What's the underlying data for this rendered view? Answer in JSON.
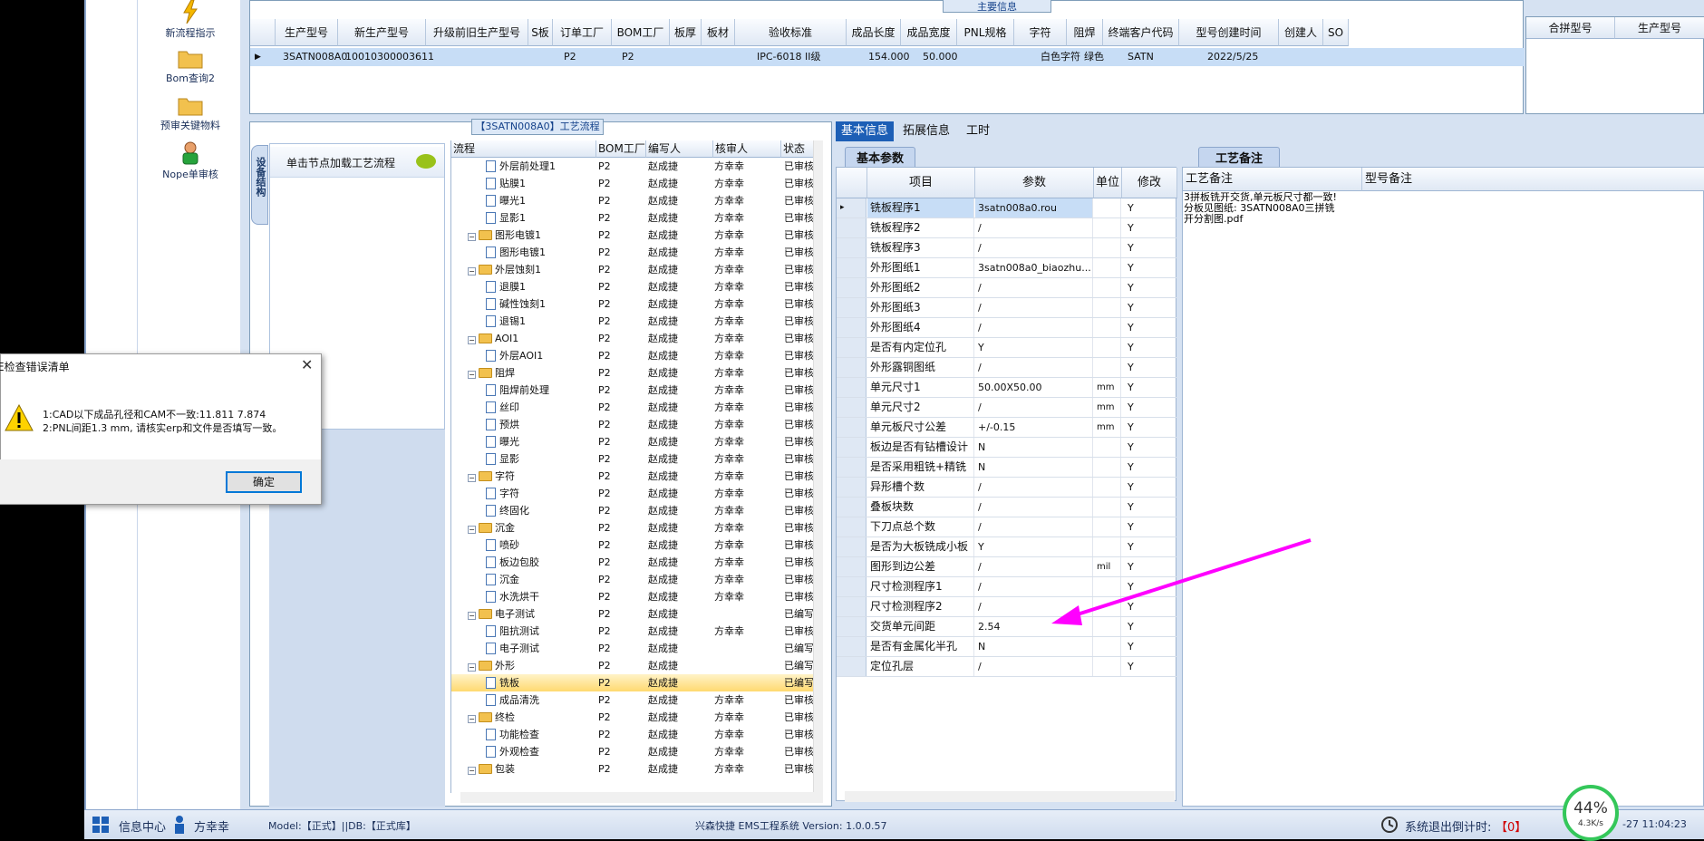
{
  "nav": {
    "items": [
      {
        "label": "新流程指示",
        "icon": "lightning-icon"
      },
      {
        "label": "Bom查询2",
        "icon": "folder-icon"
      },
      {
        "label": "预审关键物料",
        "icon": "folder-icon"
      },
      {
        "label": "Nope单审核",
        "icon": "user-icon"
      }
    ]
  },
  "main_info": {
    "caption": "主要信息",
    "headers": [
      "生产型号",
      "新生产型号",
      "升级前旧生产型号",
      "S板",
      "订单工厂",
      "BOM工厂",
      "板厚",
      "板材",
      "验收标准",
      "成品长度",
      "成品宽度",
      "PNL规格",
      "字符",
      "阻焊",
      "终端客户代码",
      "型号创建时间",
      "创建人",
      "SO"
    ],
    "row": [
      "3SATN008A0",
      "10010300003611",
      "",
      "",
      "P2",
      "P2",
      "",
      "",
      "IPC-6018 II级",
      "154.000",
      "50.000",
      "",
      "白色字符",
      "绿色",
      "SATN",
      "2022/5/25",
      "",
      ""
    ]
  },
  "right_grid": {
    "headers": [
      "合拼型号",
      "生产型号"
    ]
  },
  "flow": {
    "title": "【3SATN008A0】工艺流程",
    "side_tab": "设备结构",
    "load_hint": "单击节点加载工艺流程",
    "headers": [
      "流程",
      "BOM工厂",
      "编写人",
      "核审人",
      "状态"
    ],
    "rows": [
      {
        "n": "外层前处理1",
        "lvl": 2,
        "bom": "P2",
        "w": "赵成捷",
        "r": "方幸幸",
        "s": "已审核"
      },
      {
        "n": "贴膜1",
        "lvl": 2,
        "bom": "P2",
        "w": "赵成捷",
        "r": "方幸幸",
        "s": "已审核"
      },
      {
        "n": "曝光1",
        "lvl": 2,
        "bom": "P2",
        "w": "赵成捷",
        "r": "方幸幸",
        "s": "已审核"
      },
      {
        "n": "显影1",
        "lvl": 2,
        "bom": "P2",
        "w": "赵成捷",
        "r": "方幸幸",
        "s": "已审核"
      },
      {
        "n": "图形电镀1",
        "lvl": 1,
        "bom": "P2",
        "w": "赵成捷",
        "r": "方幸幸",
        "s": "已审核"
      },
      {
        "n": "图形电镀1",
        "lvl": 2,
        "bom": "P2",
        "w": "赵成捷",
        "r": "方幸幸",
        "s": "已审核"
      },
      {
        "n": "外层蚀刻1",
        "lvl": 1,
        "bom": "P2",
        "w": "赵成捷",
        "r": "方幸幸",
        "s": "已审核"
      },
      {
        "n": "退膜1",
        "lvl": 2,
        "bom": "P2",
        "w": "赵成捷",
        "r": "方幸幸",
        "s": "已审核"
      },
      {
        "n": "碱性蚀刻1",
        "lvl": 2,
        "bom": "P2",
        "w": "赵成捷",
        "r": "方幸幸",
        "s": "已审核"
      },
      {
        "n": "退锡1",
        "lvl": 2,
        "bom": "P2",
        "w": "赵成捷",
        "r": "方幸幸",
        "s": "已审核"
      },
      {
        "n": "AOI1",
        "lvl": 1,
        "bom": "P2",
        "w": "赵成捷",
        "r": "方幸幸",
        "s": "已审核"
      },
      {
        "n": "外层AOI1",
        "lvl": 2,
        "bom": "P2",
        "w": "赵成捷",
        "r": "方幸幸",
        "s": "已审核"
      },
      {
        "n": "阻焊",
        "lvl": 1,
        "bom": "P2",
        "w": "赵成捷",
        "r": "方幸幸",
        "s": "已审核"
      },
      {
        "n": "阻焊前处理",
        "lvl": 2,
        "bom": "P2",
        "w": "赵成捷",
        "r": "方幸幸",
        "s": "已审核"
      },
      {
        "n": "丝印",
        "lvl": 2,
        "bom": "P2",
        "w": "赵成捷",
        "r": "方幸幸",
        "s": "已审核"
      },
      {
        "n": "预烘",
        "lvl": 2,
        "bom": "P2",
        "w": "赵成捷",
        "r": "方幸幸",
        "s": "已审核"
      },
      {
        "n": "曝光",
        "lvl": 2,
        "bom": "P2",
        "w": "赵成捷",
        "r": "方幸幸",
        "s": "已审核"
      },
      {
        "n": "显影",
        "lvl": 2,
        "bom": "P2",
        "w": "赵成捷",
        "r": "方幸幸",
        "s": "已审核"
      },
      {
        "n": "字符",
        "lvl": 1,
        "bom": "P2",
        "w": "赵成捷",
        "r": "方幸幸",
        "s": "已审核"
      },
      {
        "n": "字符",
        "lvl": 2,
        "bom": "P2",
        "w": "赵成捷",
        "r": "方幸幸",
        "s": "已审核"
      },
      {
        "n": "终固化",
        "lvl": 2,
        "bom": "P2",
        "w": "赵成捷",
        "r": "方幸幸",
        "s": "已审核"
      },
      {
        "n": "沉金",
        "lvl": 1,
        "bom": "P2",
        "w": "赵成捷",
        "r": "方幸幸",
        "s": "已审核"
      },
      {
        "n": "喷砂",
        "lvl": 2,
        "bom": "P2",
        "w": "赵成捷",
        "r": "方幸幸",
        "s": "已审核"
      },
      {
        "n": "板边包胶",
        "lvl": 2,
        "bom": "P2",
        "w": "赵成捷",
        "r": "方幸幸",
        "s": "已审核"
      },
      {
        "n": "沉金",
        "lvl": 2,
        "bom": "P2",
        "w": "赵成捷",
        "r": "方幸幸",
        "s": "已审核"
      },
      {
        "n": "水洗烘干",
        "lvl": 2,
        "bom": "P2",
        "w": "赵成捷",
        "r": "方幸幸",
        "s": "已审核"
      },
      {
        "n": "电子测试",
        "lvl": 1,
        "bom": "P2",
        "w": "赵成捷",
        "r": "",
        "s": "已编写"
      },
      {
        "n": "阻抗测试",
        "lvl": 2,
        "bom": "P2",
        "w": "赵成捷",
        "r": "方幸幸",
        "s": "已审核"
      },
      {
        "n": "电子测试",
        "lvl": 2,
        "bom": "P2",
        "w": "赵成捷",
        "r": "",
        "s": "已编写"
      },
      {
        "n": "外形",
        "lvl": 1,
        "bom": "P2",
        "w": "赵成捷",
        "r": "",
        "s": "已编写"
      },
      {
        "n": "铣板",
        "lvl": 2,
        "bom": "P2",
        "w": "赵成捷",
        "r": "",
        "s": "已编写",
        "sel": true
      },
      {
        "n": "成品清洗",
        "lvl": 2,
        "bom": "P2",
        "w": "赵成捷",
        "r": "方幸幸",
        "s": "已审核"
      },
      {
        "n": "终检",
        "lvl": 1,
        "bom": "P2",
        "w": "赵成捷",
        "r": "方幸幸",
        "s": "已审核"
      },
      {
        "n": "功能检查",
        "lvl": 2,
        "bom": "P2",
        "w": "赵成捷",
        "r": "方幸幸",
        "s": "已审核"
      },
      {
        "n": "外观检查",
        "lvl": 2,
        "bom": "P2",
        "w": "赵成捷",
        "r": "方幸幸",
        "s": "已审核"
      },
      {
        "n": "包装",
        "lvl": 1,
        "bom": "P2",
        "w": "赵成捷",
        "r": "方幸幸",
        "s": "已审核"
      }
    ]
  },
  "mid_tabs": [
    "基本信息",
    "拓展信息",
    "工时"
  ],
  "params": {
    "section": "基本参数",
    "headers": [
      "项目",
      "参数",
      "单位",
      "修改"
    ],
    "rows": [
      [
        "铣板程序1",
        "3satn008a0.rou",
        "",
        "Y"
      ],
      [
        "铣板程序2",
        "/",
        "",
        "Y"
      ],
      [
        "铣板程序3",
        "/",
        "",
        "Y"
      ],
      [
        "外形图纸1",
        "3satn008a0_biaozhu...",
        "",
        "Y"
      ],
      [
        "外形图纸2",
        "/",
        "",
        "Y"
      ],
      [
        "外形图纸3",
        "/",
        "",
        "Y"
      ],
      [
        "外形图纸4",
        "/",
        "",
        "Y"
      ],
      [
        "是否有内定位孔",
        "Y",
        "",
        "Y"
      ],
      [
        "外形露铜图纸",
        "/",
        "",
        "Y"
      ],
      [
        "单元尺寸1",
        "50.00X50.00",
        "mm",
        "Y"
      ],
      [
        "单元尺寸2",
        "/",
        "mm",
        "Y"
      ],
      [
        "单元板尺寸公差",
        "+/-0.15",
        "mm",
        "Y"
      ],
      [
        "板边是否有钻槽设计",
        "N",
        "",
        "Y"
      ],
      [
        "是否采用粗铣+精铣",
        "N",
        "",
        "Y"
      ],
      [
        "异形槽个数",
        "/",
        "",
        "Y"
      ],
      [
        "叠板块数",
        "/",
        "",
        "Y"
      ],
      [
        "下刀点总个数",
        "/",
        "",
        "Y"
      ],
      [
        "是否为大板铣成小板",
        "Y",
        "",
        "Y"
      ],
      [
        "图形到边公差",
        "/",
        "mil",
        "Y"
      ],
      [
        "尺寸检测程序1",
        "/",
        "",
        "Y"
      ],
      [
        "尺寸检测程序2",
        "/",
        "",
        "Y"
      ],
      [
        "交货单元间距",
        "2.54",
        "",
        "Y"
      ],
      [
        "是否有金属化半孔",
        "N",
        "",
        "Y"
      ],
      [
        "定位孔层",
        "/",
        "",
        "Y"
      ]
    ]
  },
  "notes": {
    "section": "工艺备注",
    "headers": [
      "工艺备注",
      "型号备注"
    ],
    "text": "3拼板铣开交货,单元板尺寸都一致! 分板见图纸: 3SATN008A0三拼铣开分割图.pdf"
  },
  "status": {
    "center_label": "信息中心",
    "user": "方幸幸",
    "model": "Model:【正式】||DB:【正式库】",
    "app": "兴森快捷 EMS工程系统 Version: 1.0.0.57",
    "countdown_label": "系统退出倒计时:",
    "countdown_value": "【0】",
    "time": "-27 11:04:23",
    "net_percent": "44%",
    "net_speed": "4.3K/s",
    "net_percent_value": 0.44
  },
  "dialog": {
    "title": "E检查错误清单",
    "line1": "1:CAD以下成品孔径和CAM不一致:11.811 7.874",
    "line2": "2:PNL间距1.3 mm, 请核实erp和文件是否填写一致。",
    "ok": "确定"
  },
  "colors": {
    "accent": "#1d5fb6",
    "arrow": "#ff00ff",
    "selected": "#ffd970"
  }
}
